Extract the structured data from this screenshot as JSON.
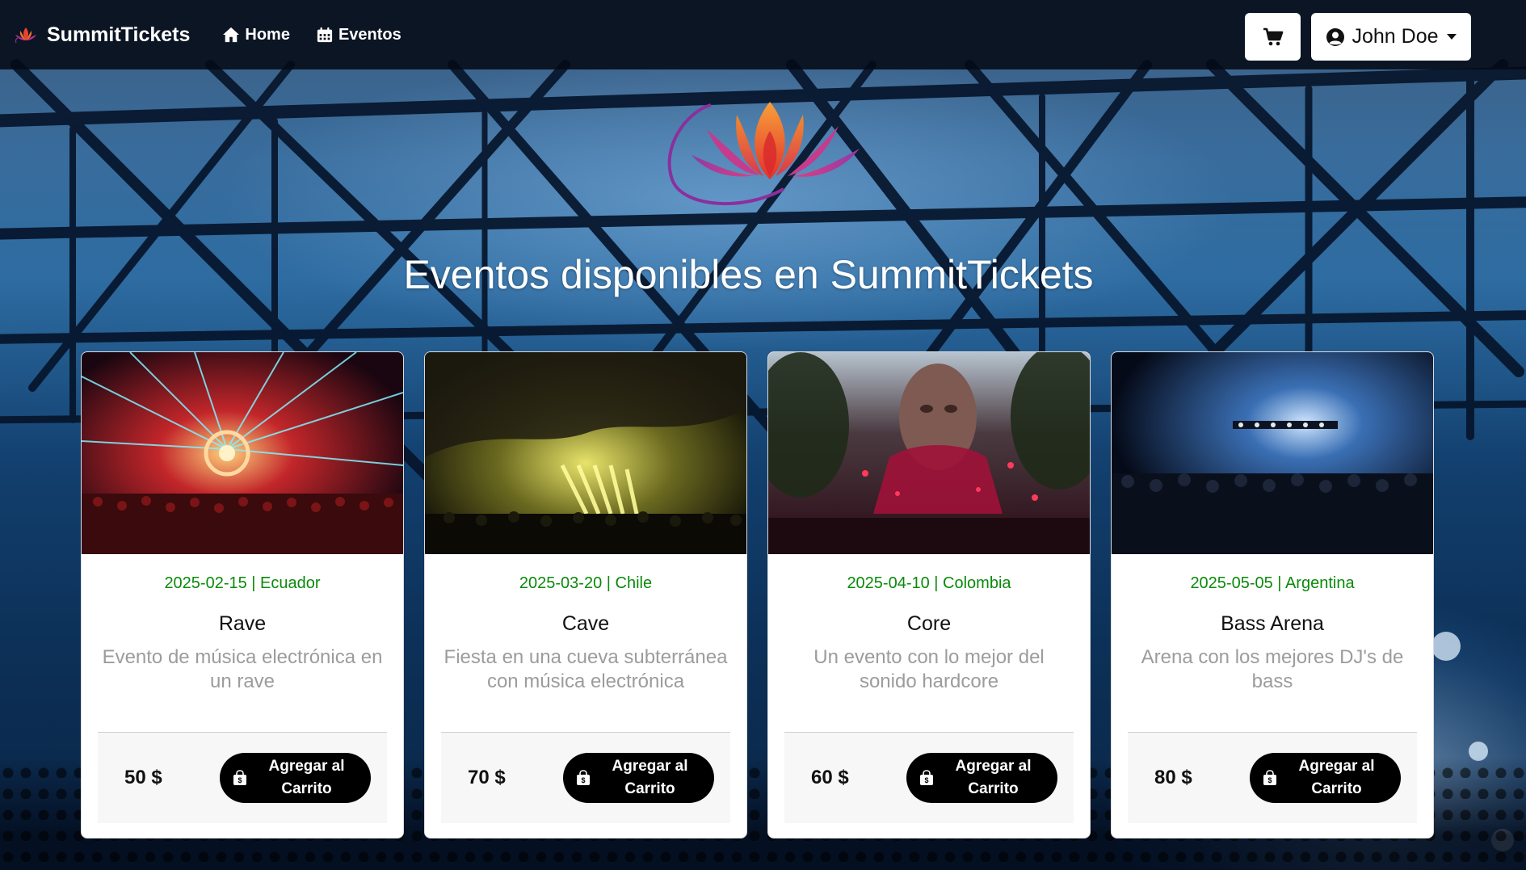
{
  "brand": {
    "name": "SummitTickets",
    "logo_icon": "lotus-logo-icon"
  },
  "nav": {
    "home_label": "Home",
    "eventos_label": "Eventos"
  },
  "user": {
    "name": "John Doe"
  },
  "page": {
    "title": "Eventos disponibles en SummitTickets"
  },
  "colors": {
    "meta_green": "#0a8a0a",
    "button_black": "#000000",
    "description_gray": "#9c9c9c",
    "navbar": "#040a16"
  },
  "events": [
    {
      "date": "2025-02-15",
      "country": "Ecuador",
      "meta": "2025-02-15 | Ecuador",
      "title": "Rave",
      "description": "Evento de música electrónica en un rave",
      "price": "50 $",
      "button_label": "Agregar al Carrito"
    },
    {
      "date": "2025-03-20",
      "country": "Chile",
      "meta": "2025-03-20 | Chile",
      "title": "Cave",
      "description": "Fiesta en una cueva subterránea con música electrónica",
      "price": "70 $",
      "button_label": "Agregar al Carrito"
    },
    {
      "date": "2025-04-10",
      "country": "Colombia",
      "meta": "2025-04-10 | Colombia",
      "title": "Core",
      "description": "Un evento con lo mejor del sonido hardcore",
      "price": "60 $",
      "button_label": "Agregar al Carrito"
    },
    {
      "date": "2025-05-05",
      "country": "Argentina",
      "meta": "2025-05-05 | Argentina",
      "title": "Bass Arena",
      "description": "Arena con los mejores DJ's de bass",
      "price": "80 $",
      "button_label": "Agregar al Carrito"
    }
  ]
}
